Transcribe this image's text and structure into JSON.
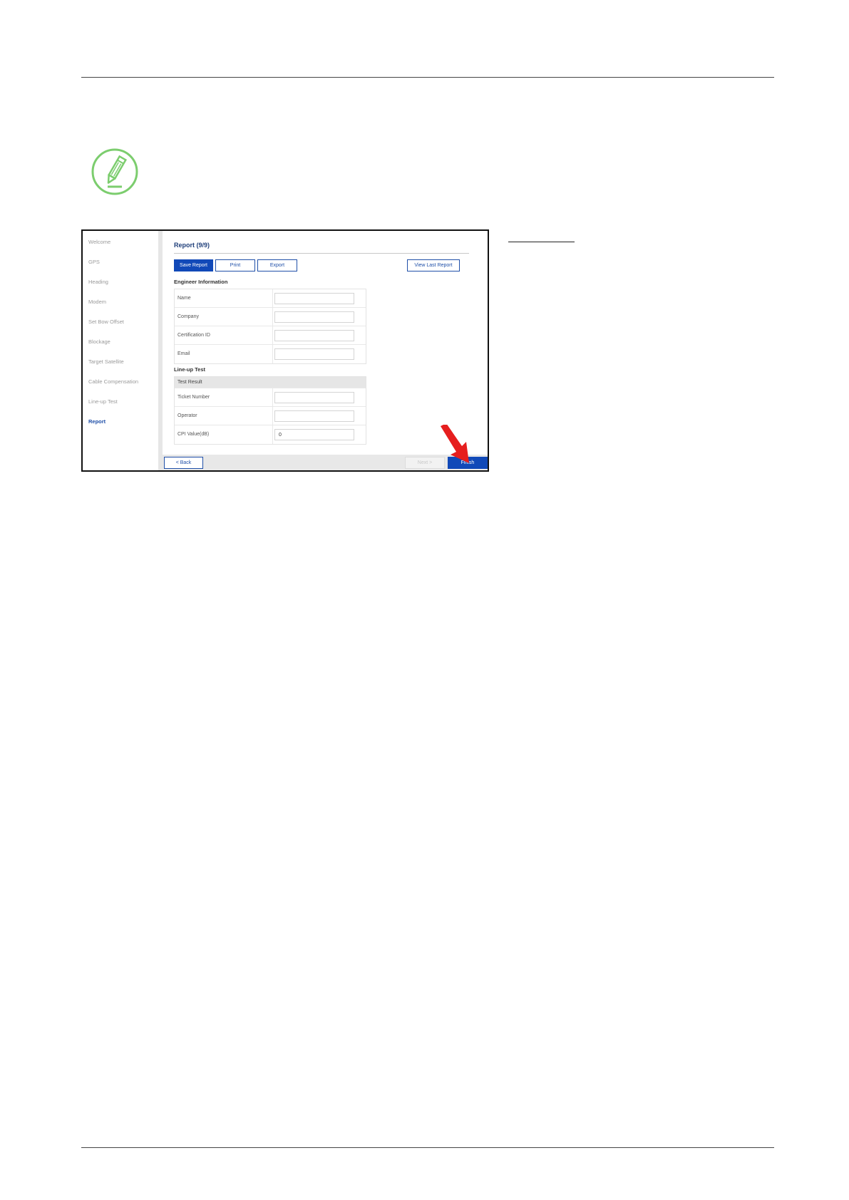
{
  "wizard": {
    "sidebar_items": [
      {
        "label": "Welcome"
      },
      {
        "label": "GPS"
      },
      {
        "label": "Heading"
      },
      {
        "label": "Modem"
      },
      {
        "label": "Set Bow Offset"
      },
      {
        "label": "Blockage"
      },
      {
        "label": "Target Satellite"
      },
      {
        "label": "Cable Compensation"
      },
      {
        "label": "Line-up Test"
      },
      {
        "label": "Report"
      }
    ],
    "active_item": "Report",
    "title": "Report (9/9)",
    "toolbar": {
      "save_report": "Save Report",
      "print": "Print",
      "export": "Export",
      "view_last_report": "View Last Report"
    },
    "engineer_section": {
      "heading": "Engineer Information",
      "fields": [
        {
          "label": "Name",
          "value": ""
        },
        {
          "label": "Company",
          "value": ""
        },
        {
          "label": "Certification ID",
          "value": ""
        },
        {
          "label": "Email",
          "value": ""
        }
      ]
    },
    "lineup_section": {
      "heading": "Line-up Test",
      "table_header": "Test Result",
      "fields": [
        {
          "label": "Ticket Number",
          "value": ""
        },
        {
          "label": "Operator",
          "value": ""
        },
        {
          "label": "CPI Value(dB)",
          "value": "0"
        }
      ]
    },
    "footer": {
      "back": "< Back",
      "next": "Next >",
      "finish": "Finish"
    }
  },
  "colors": {
    "accent": "#1149b8",
    "note_icon": "#7ccd6e",
    "arrow": "#e61e1e"
  },
  "icons": {
    "note": "pencil-note-icon",
    "pointer": "red-arrow-icon"
  }
}
